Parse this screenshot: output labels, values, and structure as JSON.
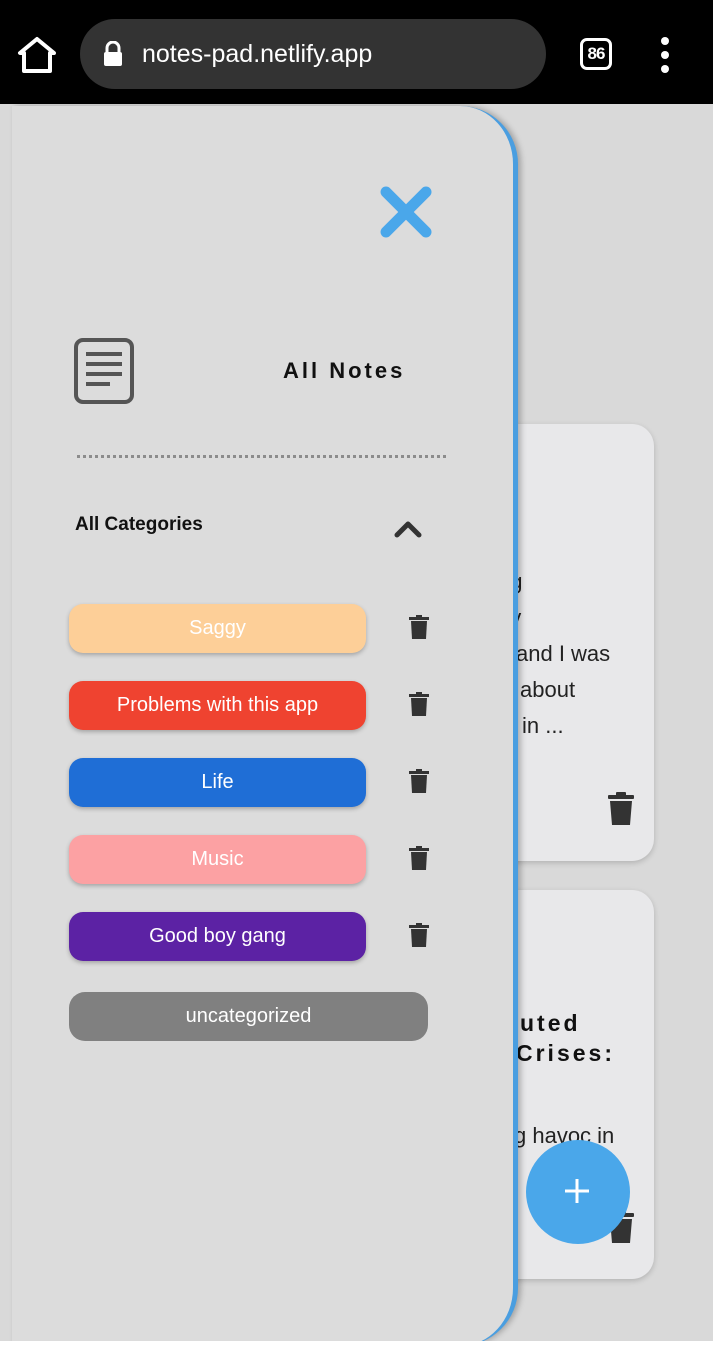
{
  "browser": {
    "url": "notes-pad.netlify.app",
    "tab_count": "86"
  },
  "background_notes": [
    {
      "body_lines": [
        "ng",
        "ny",
        "and I was",
        "about",
        "in ..."
      ]
    },
    {
      "title_lines": [
        "uted",
        "Crises:"
      ],
      "body_fragment": "g havoc in"
    }
  ],
  "drawer": {
    "title": "All Notes",
    "categories_header": "All Categories",
    "categories": [
      {
        "label": "Saggy",
        "color": "#fdcf98"
      },
      {
        "label": "Problems with this app",
        "color": "#ef4330"
      },
      {
        "label": "Life",
        "color": "#1f6ed6"
      },
      {
        "label": "Music",
        "color": "#fca1a3"
      },
      {
        "label": "Good boy gang",
        "color": "#5c22a4"
      }
    ],
    "uncategorized_label": "uncategorized"
  },
  "colors": {
    "accent": "#4aa7ea",
    "drawer_border": "#4a9ee0",
    "page_bg": "#d9d9d9"
  },
  "icons": [
    "home-icon",
    "lock-icon",
    "tabs-icon",
    "more-vert-icon",
    "close-icon",
    "notes-icon",
    "chevron-up-icon",
    "trash-icon",
    "plus-icon"
  ]
}
